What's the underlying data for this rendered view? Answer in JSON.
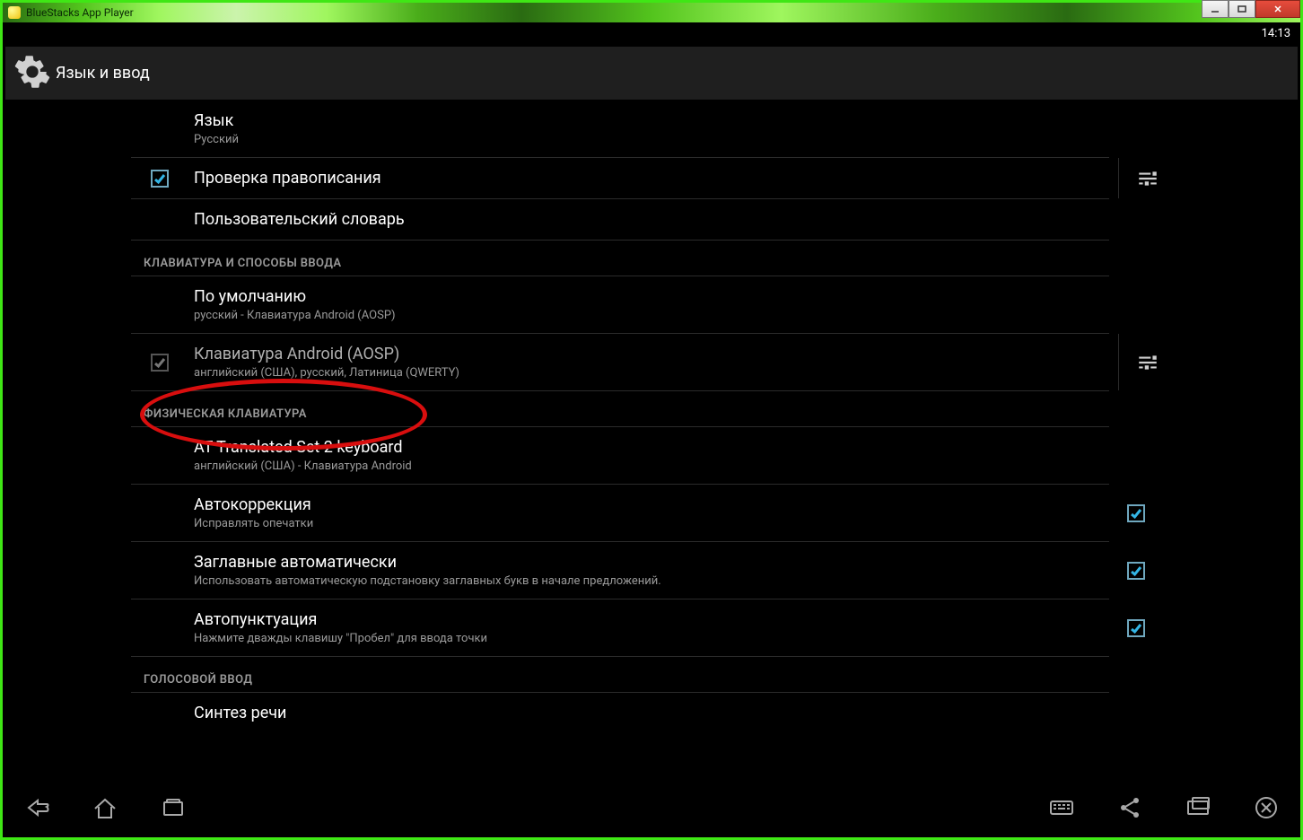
{
  "window": {
    "title": "BlueStacks App Player"
  },
  "status_bar": {
    "clock": "14:13"
  },
  "header": {
    "title": "Язык и ввод"
  },
  "settings": {
    "language_title": "Язык",
    "language_value": "Русский",
    "spellcheck_label": "Проверка правописания",
    "user_dictionary_label": "Пользовательский словарь",
    "section_keyboard": "КЛАВИАТУРА И СПОСОБЫ ВВОДА",
    "default_title": "По умолчанию",
    "default_value": "русский - Клавиатура Android (AOSP)",
    "aosp_title": "Клавиатура Android (AOSP)",
    "aosp_value": "английский (США), русский, Латиница (QWERTY)",
    "section_physical": "ФИЗИЧЕСКАЯ КЛАВИАТУРА",
    "at_translated_title": "AT Translated Set 2 keyboard",
    "at_translated_value": "английский (США) - Клавиатура Android",
    "autocorrect_title": "Автокоррекция",
    "autocorrect_sub": "Исправлять опечатки",
    "autocap_title": "Заглавные автоматически",
    "autocap_sub": "Использовать автоматическую подстановку заглавных букв в начале предложений.",
    "autopunct_title": "Автопунктуация",
    "autopunct_sub": "Нажмите дважды клавишу \"Пробел\" для ввода точки",
    "section_voice": "ГОЛОСОВОЙ ВВОД",
    "tts_title": "Синтез речи"
  }
}
